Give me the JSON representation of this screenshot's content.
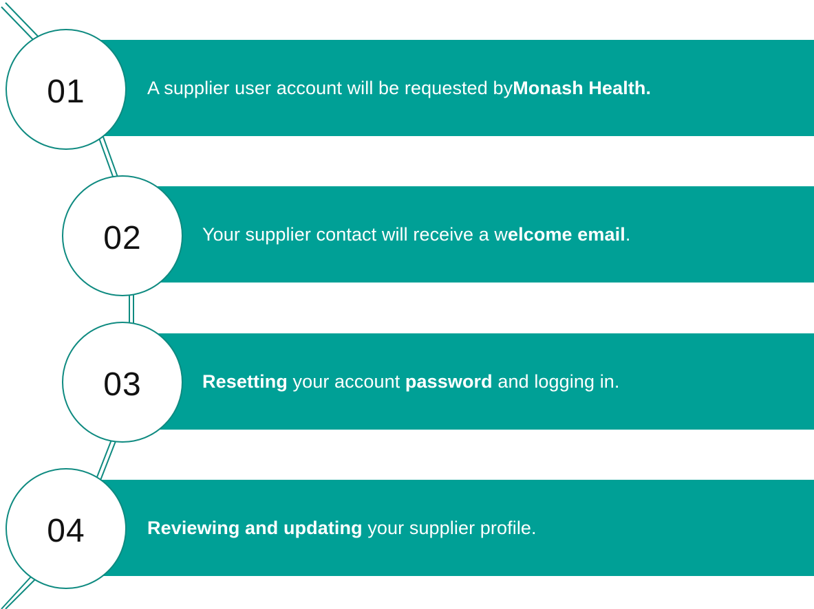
{
  "colors": {
    "band": "#00A096",
    "circle_border": "#0E8A80",
    "connector": "#0E8A80",
    "text_on_band": "#FFFFFF",
    "number": "#111111"
  },
  "steps": [
    {
      "number": "01",
      "segments": [
        {
          "text": "A supplier user account will be requested by ",
          "bold": false
        },
        {
          "text": "Monash Health.",
          "bold": true
        }
      ]
    },
    {
      "number": "02",
      "segments": [
        {
          "text": "Your supplier contact will receive a w",
          "bold": false
        },
        {
          "text": "elcome email",
          "bold": true
        },
        {
          "text": ".",
          "bold": false
        }
      ]
    },
    {
      "number": "03",
      "segments": [
        {
          "text": "Resetting",
          "bold": true
        },
        {
          "text": " your account ",
          "bold": false
        },
        {
          "text": "password",
          "bold": true
        },
        {
          "text": " and logging in.",
          "bold": false
        }
      ]
    },
    {
      "number": "04",
      "segments": [
        {
          "text": "Reviewing and updating",
          "bold": true
        },
        {
          "text": " your supplier profile.",
          "bold": false
        }
      ]
    }
  ]
}
